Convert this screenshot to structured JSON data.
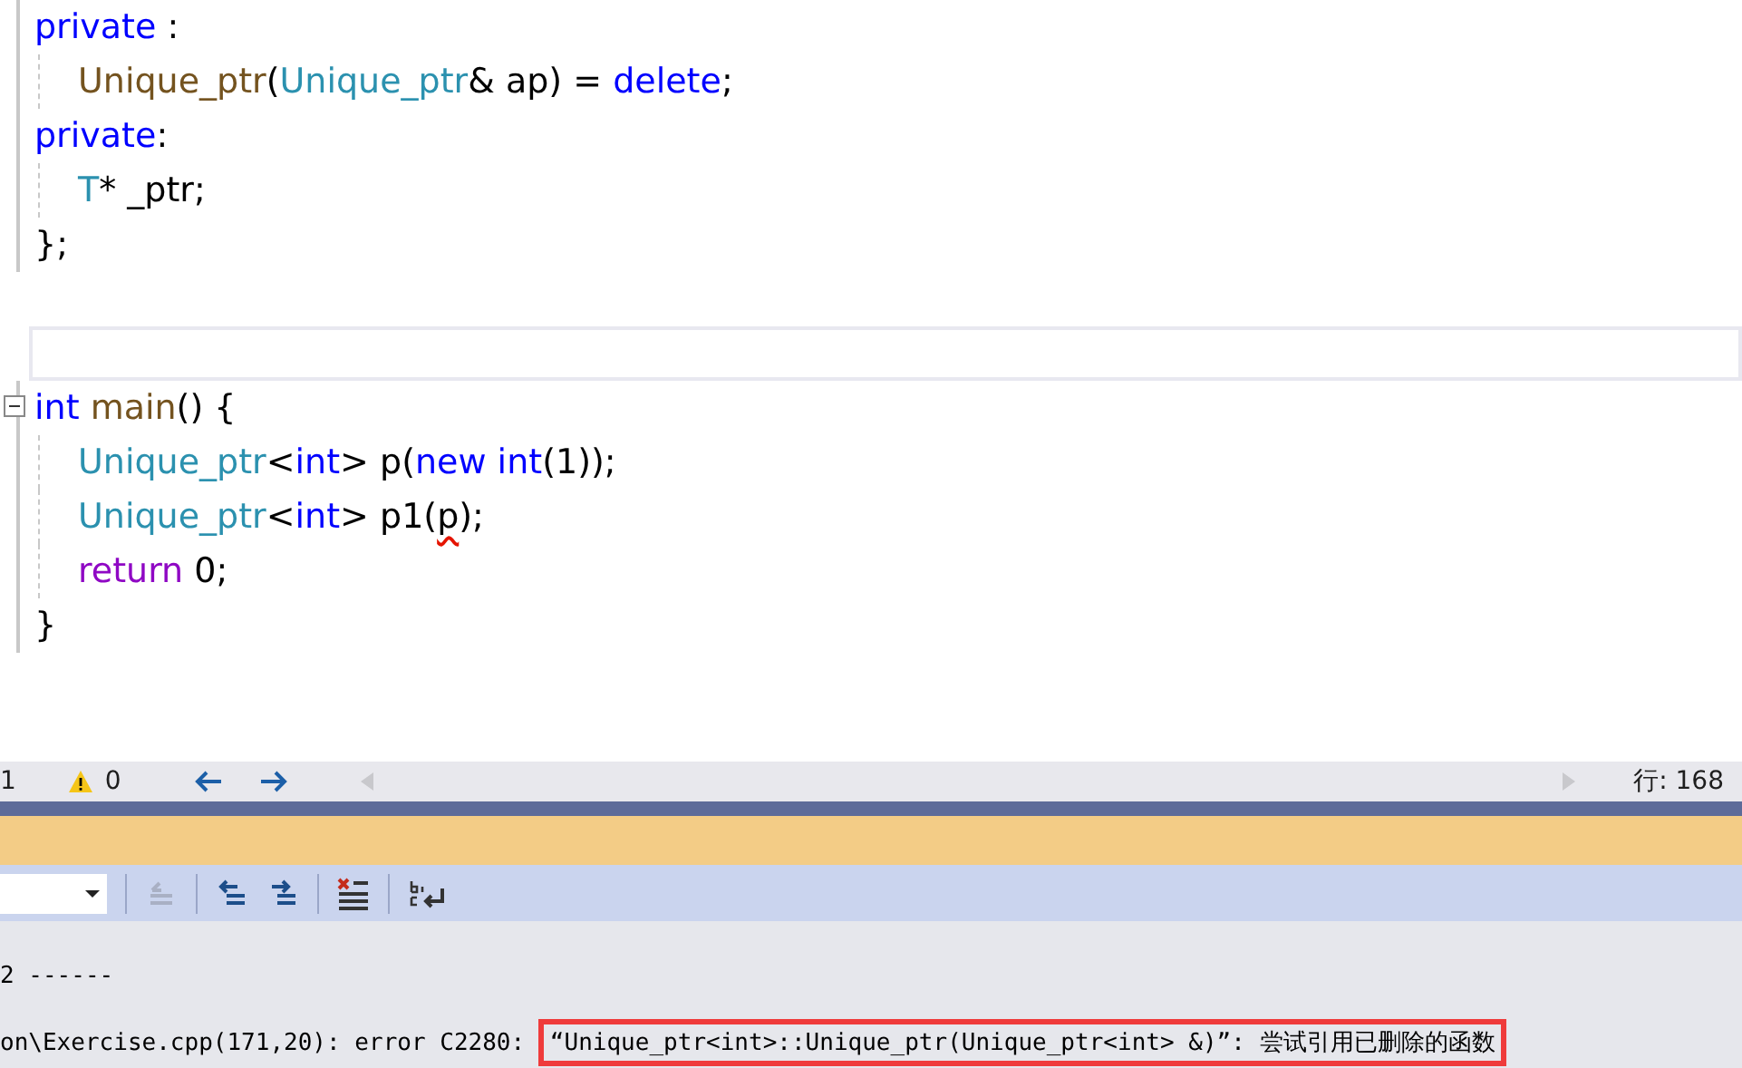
{
  "editor": {
    "blocks": [
      {
        "kind": "block",
        "collapsible": false,
        "lines": [
          {
            "indented": false,
            "tokens": [
              {
                "kind": "keyword",
                "text": "private"
              },
              {
                "kind": "plain",
                "text": " :"
              }
            ]
          },
          {
            "indented": true,
            "tokens": [
              {
                "kind": "func",
                "text": "Unique_ptr"
              },
              {
                "kind": "plain",
                "text": "("
              },
              {
                "kind": "type",
                "text": "Unique_ptr"
              },
              {
                "kind": "plain",
                "text": "& ap) = "
              },
              {
                "kind": "keyword",
                "text": "delete"
              },
              {
                "kind": "plain",
                "text": ";"
              }
            ]
          },
          {
            "indented": false,
            "tokens": [
              {
                "kind": "keyword",
                "text": "private"
              },
              {
                "kind": "plain",
                "text": ":"
              }
            ]
          },
          {
            "indented": true,
            "tokens": [
              {
                "kind": "type",
                "text": "T"
              },
              {
                "kind": "plain",
                "text": "* _ptr;"
              }
            ]
          },
          {
            "indented": false,
            "tokens": [
              {
                "kind": "plain",
                "text": "};"
              }
            ]
          }
        ]
      },
      {
        "kind": "current-line"
      },
      {
        "kind": "block",
        "collapsible": true,
        "lines": [
          {
            "indented": false,
            "tokens": [
              {
                "kind": "keyword",
                "text": "int"
              },
              {
                "kind": "func",
                "text": " main"
              },
              {
                "kind": "plain",
                "text": "() {"
              }
            ]
          },
          {
            "indented": true,
            "tokens": [
              {
                "kind": "type",
                "text": "Unique_ptr"
              },
              {
                "kind": "plain",
                "text": "<"
              },
              {
                "kind": "keyword",
                "text": "int"
              },
              {
                "kind": "plain",
                "text": "> p("
              },
              {
                "kind": "keyword",
                "text": "new int"
              },
              {
                "kind": "plain",
                "text": "(1));"
              }
            ]
          },
          {
            "indented": true,
            "tokens": [
              {
                "kind": "type",
                "text": "Unique_ptr"
              },
              {
                "kind": "plain",
                "text": "<"
              },
              {
                "kind": "keyword",
                "text": "int"
              },
              {
                "kind": "plain",
                "text": "> p1("
              },
              {
                "kind": "error",
                "text": "p"
              },
              {
                "kind": "plain",
                "text": ");"
              }
            ]
          },
          {
            "indented": true,
            "tokens": [
              {
                "kind": "control",
                "text": "return"
              },
              {
                "kind": "plain",
                "text": " 0;"
              }
            ]
          },
          {
            "indented": false,
            "tokens": [
              {
                "kind": "plain",
                "text": "}"
              }
            ]
          }
        ]
      }
    ]
  },
  "status_bar": {
    "errors": "1",
    "warnings": "0",
    "line": "行: 168"
  },
  "output": {
    "lines": [
      {
        "text": "2 ------"
      },
      {
        "text": "on\\Exercise.cpp(171,20): error C2280: ",
        "error_message": "“Unique_ptr<int>::Unique_ptr(Unique_ptr<int> &)”: 尝试引用已删除的函数"
      }
    ]
  }
}
